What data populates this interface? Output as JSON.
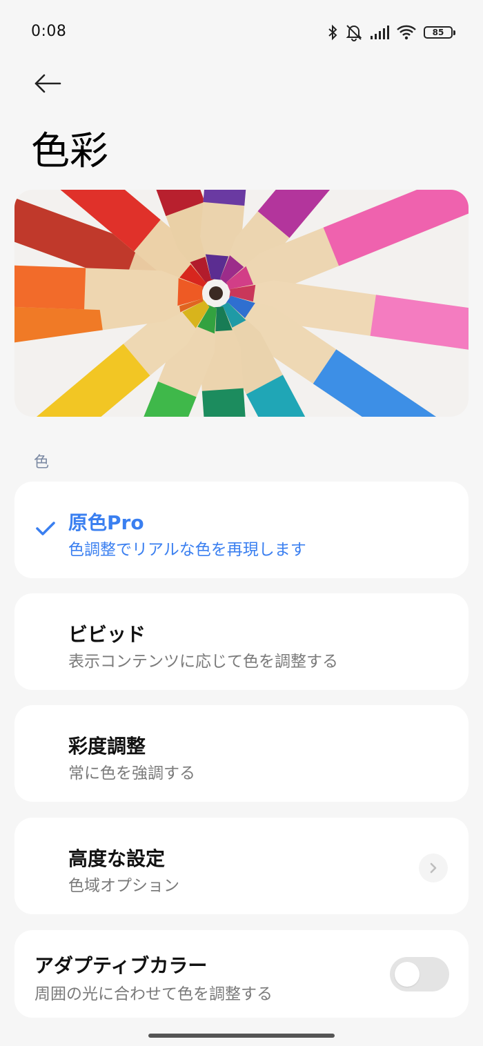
{
  "status_bar": {
    "time": "0:08",
    "battery_level": "85",
    "icons": [
      "bluetooth-icon",
      "mute-icon",
      "signal-icon",
      "wifi-icon",
      "battery-icon"
    ]
  },
  "header": {
    "back_icon": "arrow-left-icon",
    "title": "色彩"
  },
  "hero_image": {
    "subject": "colored-pencils-wheel"
  },
  "section": {
    "label": "色"
  },
  "options": [
    {
      "title": "原色Pro",
      "subtitle": "色調整でリアルな色を再現します",
      "selected": true
    },
    {
      "title": "ビビッド",
      "subtitle": "表示コンテンツに応じて色を調整する",
      "selected": false
    },
    {
      "title": "彩度調整",
      "subtitle": "常に色を強調する",
      "selected": false
    }
  ],
  "advanced": {
    "title": "高度な設定",
    "subtitle": "色域オプション",
    "icon": "chevron-right-icon"
  },
  "adaptive": {
    "title": "アダプティブカラー",
    "subtitle": "周囲の光に合わせて色を調整する",
    "enabled": false
  },
  "colors": {
    "accent": "#3a7ff0",
    "background": "#f6f6f6",
    "card": "#ffffff",
    "section_label": "#7c8aa3",
    "subtitle": "#7a7a7a"
  }
}
